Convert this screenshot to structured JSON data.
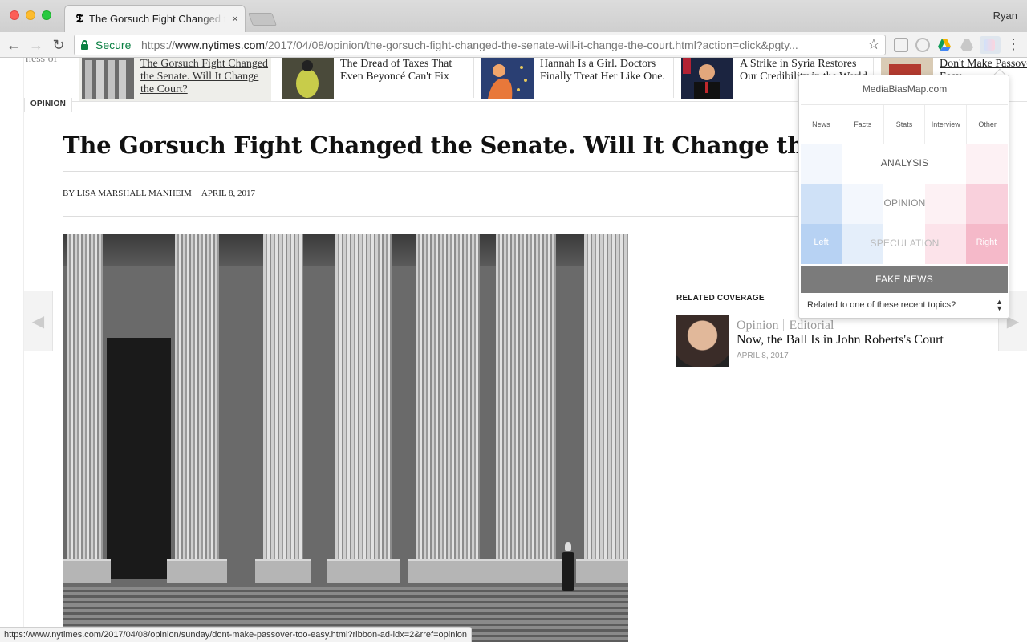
{
  "browser": {
    "tab_title": "The Gorsuch Fight Changed the Senate. Will It Change the Court?",
    "tab_close": "×",
    "user": "Ryan",
    "secure_label": "Secure",
    "url_scheme": "https://",
    "url_host": "www.nytimes.com",
    "url_path": "/2017/04/08/opinion/the-gorsuch-fight-changed-the-senate-will-it-change-the-court.html?action=click&pgty...",
    "back_icon": "←",
    "forward_icon": "→",
    "reload_icon": "↻",
    "star_icon": "☆",
    "menu_icon": "⋮",
    "favicon": "𝕿",
    "status_url": "https://www.nytimes.com/2017/04/08/opinion/sunday/dont-make-passover-too-easy.html?ribbon-ad-idx=2&rref=opinion"
  },
  "ribbon": {
    "prev_fragment": "ness of",
    "items": [
      {
        "title": "The Gorsuch Fight Changed the Senate. Will It Change the Court?"
      },
      {
        "title": "The Dread of Taxes That Even Beyoncé Can't Fix"
      },
      {
        "title": "Hannah Is a Girl. Doctors Finally Treat Her Like One."
      },
      {
        "title": "A Strike in Syria Restores Our Credibility in the World"
      },
      {
        "title": "Don't Make Passover Too Easy"
      }
    ]
  },
  "article": {
    "section": "OPINION",
    "headline": "The Gorsuch Fight Changed the Senate. Will It Change the Court?",
    "byline": "By LISA MARSHALL MANHEIM",
    "date": "APRIL 8, 2017"
  },
  "related": {
    "label": "RELATED COVERAGE",
    "kicker_section": "Opinion",
    "kicker_type": "Editorial",
    "title": "Now, the Ball Is in John Roberts's Court",
    "date": "APRIL 8, 2017"
  },
  "nav_arrows": {
    "left": "◀",
    "right": "▶"
  },
  "popup": {
    "title": "MediaBiasMap.com",
    "tabs": [
      "News",
      "Facts",
      "Stats",
      "Interview",
      "Other"
    ],
    "rows": [
      "ANALYSIS",
      "OPINION",
      "SPECULATION"
    ],
    "left_label": "Left",
    "right_label": "Right",
    "fake_news": "FAKE NEWS",
    "topics_placeholder": "Related to one of these recent topics?",
    "colors": {
      "left_strong": "#cfe1f7",
      "left_mid": "#e4eefa",
      "left_light": "#f3f7fd",
      "right_strong": "#f9d0dc",
      "right_mid": "#fce3ea",
      "right_light": "#fdf1f4",
      "neutral": "#ffffff",
      "fake": "#7b7b7b"
    }
  }
}
